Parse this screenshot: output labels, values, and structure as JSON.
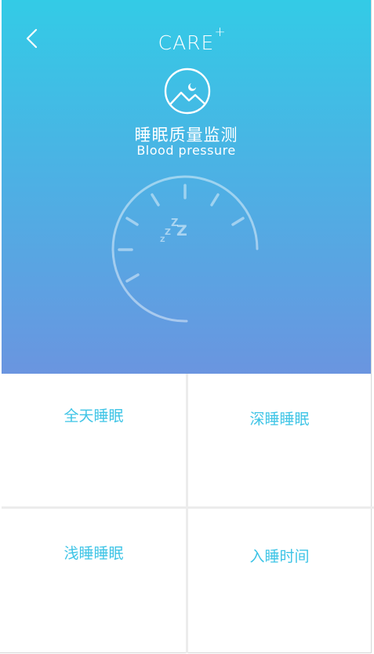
{
  "header": {
    "brand": "CARE",
    "brand_mark": "+",
    "back_icon": "chevron-left-icon",
    "logo_icon": "moon-mountain-icon"
  },
  "hero": {
    "title_zh": "睡眠质量监测",
    "title_en": "Blood pressure",
    "gauge_icon": "sleep-gauge-icon",
    "gradient": [
      "#33cbe6",
      "#6a95e0"
    ]
  },
  "grid": {
    "items": [
      {
        "label": "全天睡眠"
      },
      {
        "label": "深睡睡眠"
      },
      {
        "label": "浅睡睡眠"
      },
      {
        "label": "入睡时间"
      }
    ],
    "text_color": "#3ec4e6"
  }
}
